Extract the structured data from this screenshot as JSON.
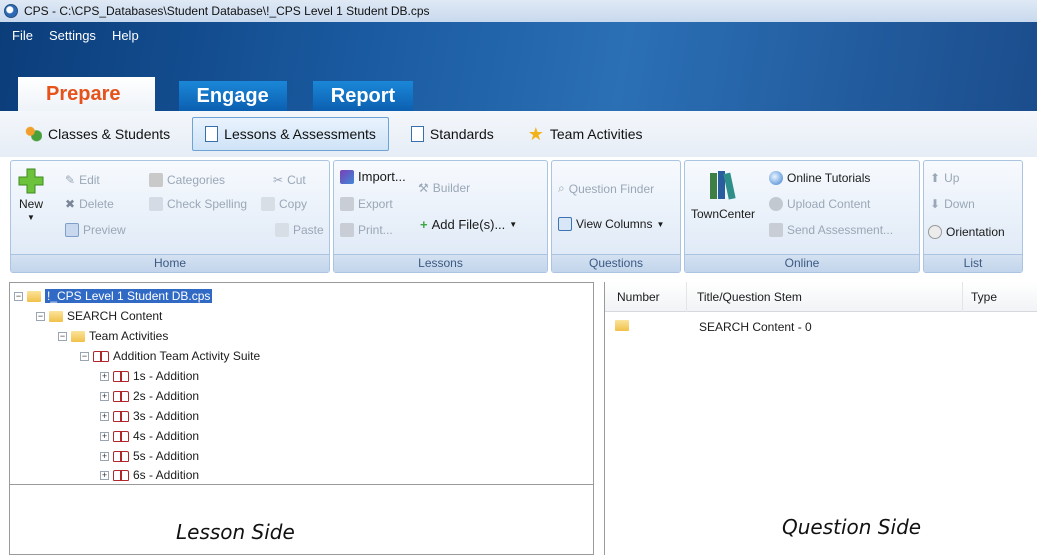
{
  "window": {
    "title": "CPS - C:\\CPS_Databases\\Student Database\\!_CPS Level 1 Student DB.cps"
  },
  "menu": [
    "File",
    "Settings",
    "Help"
  ],
  "main_tabs": [
    {
      "label": "Prepare",
      "active": true
    },
    {
      "label": "Engage",
      "active": false
    },
    {
      "label": "Report",
      "active": false
    }
  ],
  "sub_tabs": [
    {
      "label": "Classes & Students",
      "icon": "people-icon"
    },
    {
      "label": "Lessons & Assessments",
      "icon": "document-icon",
      "active": true
    },
    {
      "label": "Standards",
      "icon": "document-icon"
    },
    {
      "label": "Team Activities",
      "icon": "star-icon"
    }
  ],
  "ribbon": {
    "home": {
      "label": "Home",
      "new": "New",
      "edit": "Edit",
      "delete": "Delete",
      "preview": "Preview",
      "categories": "Categories",
      "check_spelling": "Check Spelling",
      "cut": "Cut",
      "copy": "Copy",
      "paste": "Paste"
    },
    "lessons": {
      "label": "Lessons",
      "import": "Import...",
      "builder": "Builder",
      "export": "Export",
      "add_files": "Add File(s)...",
      "print": "Print..."
    },
    "questions": {
      "label": "Questions",
      "question_finder": "Question Finder",
      "view_columns": "View Columns"
    },
    "online": {
      "label": "Online",
      "towncenter": "TownCenter",
      "online_tutorials": "Online Tutorials",
      "upload_content": "Upload Content",
      "send_assessment": "Send Assessment..."
    },
    "list": {
      "label": "List",
      "up": "Up",
      "down": "Down",
      "orientation": "Orientation"
    }
  },
  "tree": {
    "root": "!_CPS Level 1 Student DB.cps",
    "search": "SEARCH Content",
    "team": "Team Activities",
    "suite": "Addition Team Activity Suite",
    "items": [
      "1s - Addition",
      "2s - Addition",
      "3s - Addition",
      "4s - Addition",
      "5s - Addition",
      "6s - Addition"
    ]
  },
  "question_table": {
    "columns": [
      "Number",
      "Title/Question Stem",
      "Type"
    ],
    "rows": [
      {
        "title": "SEARCH Content  - 0"
      }
    ]
  },
  "captions": {
    "lesson": "Lesson Side",
    "question": "Question Side"
  }
}
